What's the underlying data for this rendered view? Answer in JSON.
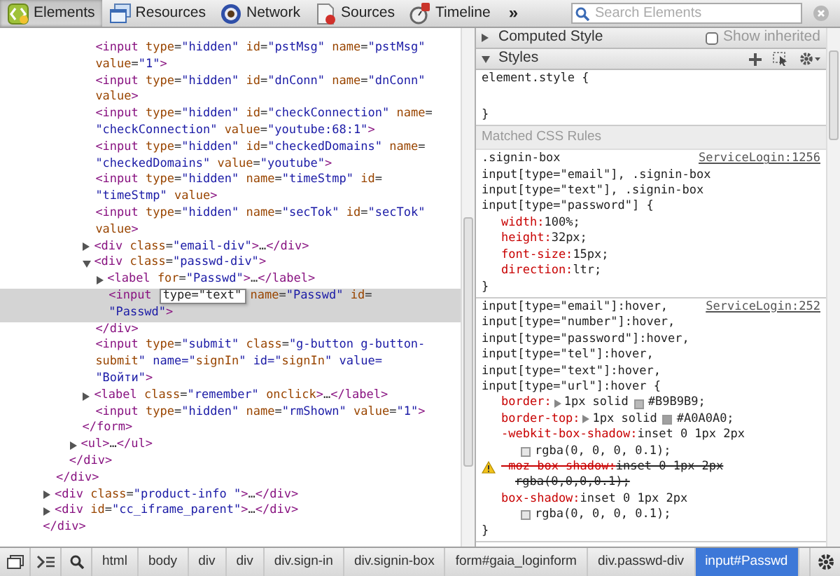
{
  "toolbar": {
    "tabs": [
      {
        "label": "Elements",
        "selected": true
      },
      {
        "label": "Resources",
        "selected": false
      },
      {
        "label": "Network",
        "selected": false
      },
      {
        "label": "Sources",
        "selected": false
      },
      {
        "label": "Timeline",
        "selected": false
      }
    ],
    "overflow": "»",
    "search": {
      "placeholder": "Search Elements"
    }
  },
  "dom_tree": [
    {
      "close": "</div>",
      "children": [
        {
          "close": "</div>",
          "children": [
            {
              "close": "</div>",
              "children": [
                {
                  "close": "</form>",
                  "children": [
                    {
                      "lines": [
                        "<input type=\"hidden\" id=\"pstMsg\" name=\"pstMsg\"",
                        "value=\"1\">"
                      ],
                      "selected": false
                    },
                    {
                      "lines": [
                        "<input type=\"hidden\" id=\"dnConn\" name=\"dnConn\"",
                        "value>"
                      ],
                      "selected": false
                    },
                    {
                      "lines": [
                        "<input type=\"hidden\" id=\"checkConnection\" name=",
                        "\"checkConnection\" value=\"youtube:68:1\">"
                      ],
                      "selected": false
                    },
                    {
                      "lines": [
                        "<input type=\"hidden\" id=\"checkedDomains\" name=",
                        "\"checkedDomains\" value=\"youtube\">"
                      ],
                      "selected": false
                    },
                    {
                      "lines": [
                        "<input type=\"hidden\" name=\"timeStmp\" id=",
                        "\"timeStmp\" value>"
                      ],
                      "selected": false
                    },
                    {
                      "lines": [
                        "<input type=\"hidden\" name=\"secTok\" id=\"secTok\"",
                        "value>"
                      ],
                      "selected": false
                    },
                    {
                      "lines": [
                        "<div class=\"email-div\">…</div>"
                      ],
                      "expanded": false,
                      "selected": false
                    },
                    {
                      "lines": [
                        "<div class=\"passwd-div\">"
                      ],
                      "expanded": true,
                      "selected": false,
                      "close": "</div>",
                      "children": [
                        {
                          "lines": [
                            "<label for=\"Passwd\">…</label>"
                          ],
                          "expanded": false,
                          "selected": false
                        },
                        {
                          "tag_start": "<input",
                          "editing": "type=\"text\"",
                          "lines": [
                            "name=\"Passwd\" id=",
                            "\"Passwd\">"
                          ],
                          "selected": true
                        }
                      ]
                    },
                    {
                      "lines": [
                        "<input type=\"submit\" class=\"g-button g-button-",
                        "submit\" name=\"signIn\" id=\"signIn\" value=",
                        "\"Войти\">"
                      ],
                      "selected": false
                    },
                    {
                      "lines": [
                        "<label class=\"remember\" onclick>…</label>"
                      ],
                      "expanded": false,
                      "selected": false
                    },
                    {
                      "lines": [
                        "<input type=\"hidden\" name=\"rmShown\" value=\"1\">"
                      ],
                      "selected": false
                    }
                  ]
                },
                {
                  "lines": [
                    "<ul>…</ul>"
                  ],
                  "expanded": false,
                  "selected": false
                }
              ]
            }
          ]
        },
        {
          "lines": [
            "<div class=\"product-info \">…</div>"
          ],
          "expanded": false,
          "selected": false
        },
        {
          "lines": [
            "<div id=\"cc_iframe_parent\">…</div>"
          ],
          "expanded": false,
          "selected": false
        }
      ]
    }
  ],
  "styles_pane": {
    "computed_style": {
      "title": "Computed Style",
      "expanded": false,
      "show_inherited": {
        "label": "Show inherited",
        "checked": false
      }
    },
    "styles": {
      "title": "Styles",
      "expanded": true
    },
    "element_style": {
      "open": "element.style {",
      "close": "}"
    },
    "matched_header": "Matched CSS Rules",
    "rules": [
      {
        "selectors": [
          ".signin-box",
          "input[type=\"email\"], .signin-box",
          "input[type=\"text\"], .signin-box",
          "input[type=\"password\"] {"
        ],
        "source": "ServiceLogin:1256",
        "close": "}",
        "properties": [
          {
            "name": "width:",
            "value": "100%;",
            "invalid": false
          },
          {
            "name": "height:",
            "value": "32px;",
            "invalid": false
          },
          {
            "name": "font-size:",
            "value": "15px;",
            "invalid": false
          },
          {
            "name": "direction:",
            "value": "ltr;",
            "invalid": false
          }
        ]
      },
      {
        "selectors": [
          "input[type=\"email\"]:hover,",
          "input[type=\"number\"]:hover,",
          "input[type=\"password\"]:hover,",
          "input[type=\"tel\"]:hover,",
          "input[type=\"text\"]:hover,",
          "input[type=\"url\"]:hover {"
        ],
        "source": "ServiceLogin:252",
        "close": "}",
        "properties": [
          {
            "name": "border:",
            "value": "1px solid",
            "color": "#b9b9b9",
            "swatch_value": "#B9B9B9;",
            "expandable": true,
            "invalid": false
          },
          {
            "name": "border-top:",
            "value": "1px solid",
            "color": "#a0a0a0",
            "swatch_value": "#A0A0A0;",
            "expandable": true,
            "invalid": false
          },
          {
            "name": "-webkit-box-shadow:",
            "value": "inset 0 1px 2px",
            "color": "#e6e6e6",
            "swatch_value": "rgba(0, 0, 0, 0.1);",
            "invalid": false,
            "wrapped": true
          },
          {
            "name": "-moz-box-shadow:",
            "value": "inset 0 1px 2px",
            "swatch_value": "rgba(0,0,0,0.1);",
            "invalid": true,
            "wrapped": true
          },
          {
            "name": "box-shadow:",
            "value": "inset 0 1px 2px",
            "color": "#e6e6e6",
            "swatch_value": "rgba(0, 0, 0, 0.1);",
            "invalid": false,
            "wrapped": true
          }
        ]
      }
    ]
  },
  "breadcrumbs": [
    {
      "label": "html",
      "selected": false
    },
    {
      "label": "body",
      "selected": false
    },
    {
      "label": "div",
      "selected": false
    },
    {
      "label": "div",
      "selected": false
    },
    {
      "label": "div.sign-in",
      "selected": false
    },
    {
      "label": "div.signin-box",
      "selected": false
    },
    {
      "label": "form#gaia_loginform",
      "selected": false
    },
    {
      "label": "div.passwd-div",
      "selected": false
    },
    {
      "label": "input#Passwd",
      "selected": true
    }
  ]
}
